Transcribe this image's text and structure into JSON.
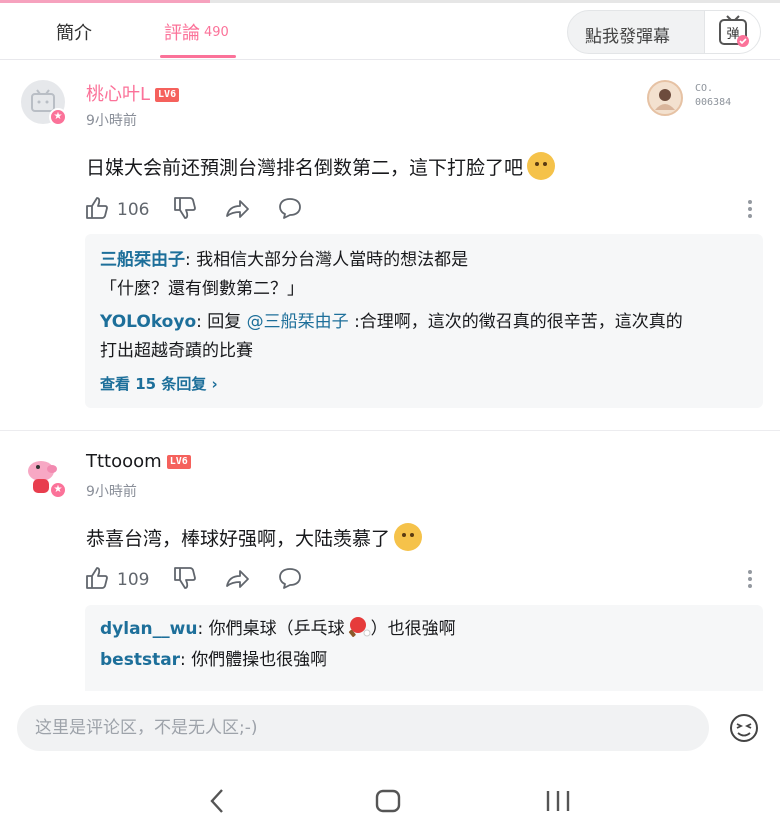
{
  "tabs": {
    "intro": "簡介",
    "comments": "評論",
    "comments_count": "490"
  },
  "danmaku": {
    "placeholder": "點我發彈幕",
    "button_label": "弹"
  },
  "comments": [
    {
      "username": "桃心叶L",
      "level": "LV6",
      "time": "9小時前",
      "text": "日媒大会前还預測台灣排名倒数第二，這下打脸了吧",
      "likes": "106",
      "medal": {
        "line1": "CO.",
        "line2": "006384"
      },
      "replies": [
        {
          "name": "三船栞由子",
          "sep": ": ",
          "text1": "我相信大部分台灣人當時的想法都是",
          "text2": "「什麼？還有倒數第二？」"
        },
        {
          "name": "YOLOkoyo",
          "sep": ": ",
          "prefix": "回复 ",
          "mention": "@三船栞由子",
          "text1": " :合理啊，這次的徵召真的很辛苦，這次真的",
          "text2": "打出超越奇蹟的比賽"
        }
      ],
      "view_more": "查看 15 条回复 ›"
    },
    {
      "username": "Tttooom",
      "level": "LV6",
      "time": "9小時前",
      "text": "恭喜台湾，棒球好强啊，大陆羡慕了",
      "likes": "109",
      "replies": [
        {
          "name": "dylan__wu",
          "sep": ": ",
          "text1": "你們桌球（乒乓球",
          "text1b": "）也很強啊"
        },
        {
          "name": "beststar",
          "sep": ": ",
          "text1": "你們體操也很強啊"
        }
      ]
    }
  ],
  "input": {
    "placeholder": "这里是评论区，不是无人区;-)"
  },
  "colors": {
    "accent": "#fb7299",
    "link": "#1d6f9a",
    "level": "#f5615c"
  }
}
